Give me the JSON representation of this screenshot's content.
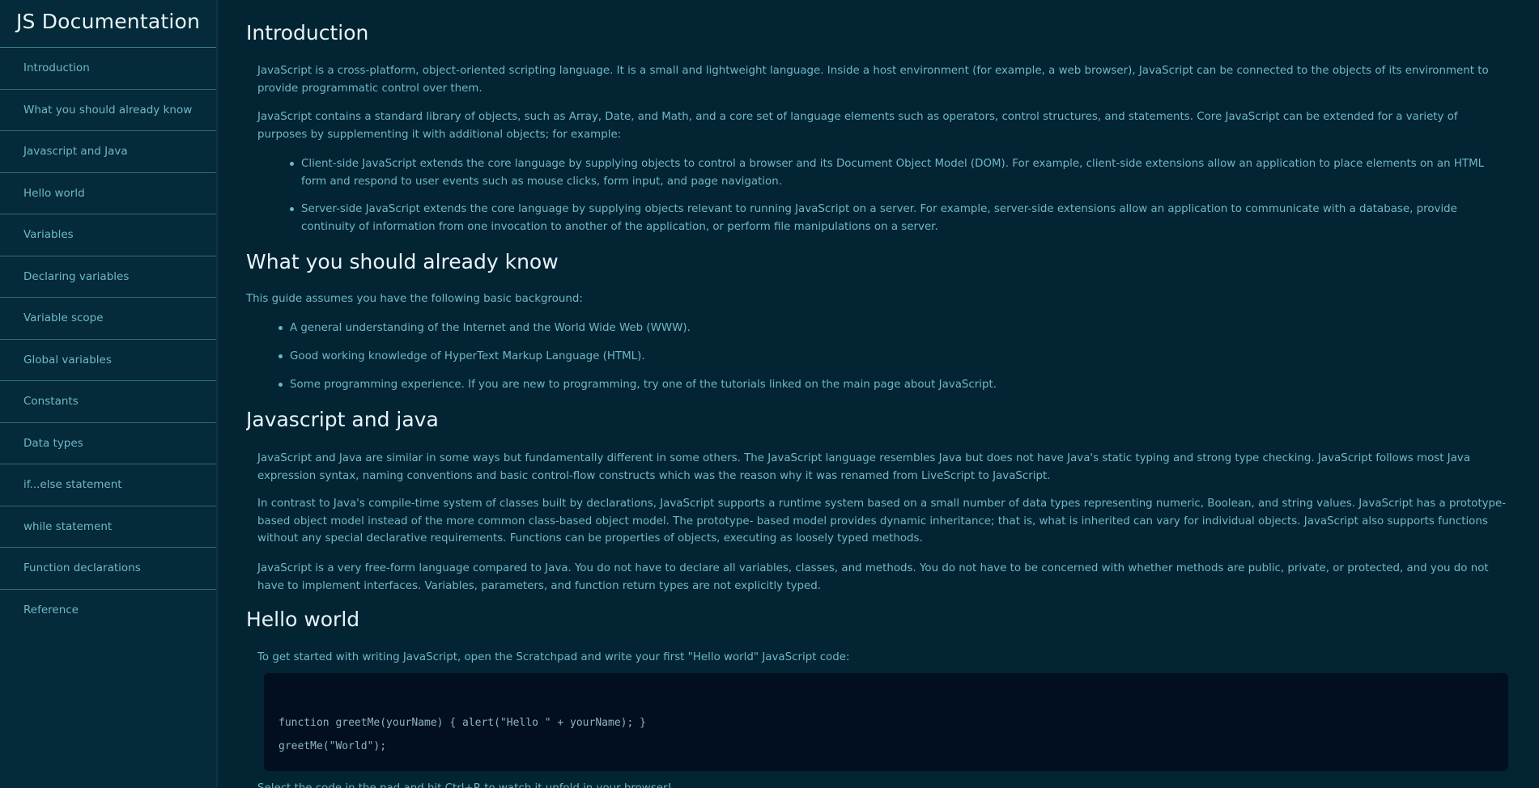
{
  "nav": {
    "header": "JS Documentation",
    "links": [
      "Introduction",
      "What you should already know",
      "Javascript and Java",
      "Hello world",
      "Variables",
      "Declaring variables",
      "Variable scope",
      "Global variables",
      "Constants",
      "Data types",
      "if...else statement",
      "while statement",
      "Function declarations",
      "Reference"
    ]
  },
  "sections": {
    "introduction": {
      "title": "Introduction",
      "p1": "JavaScript is a cross-platform, object-oriented scripting language. It is a small and lightweight language. Inside a host environment (for example, a web browser), JavaScript can be connected to the objects of its environment to provide programmatic control over them.",
      "p2": "JavaScript contains a standard library of objects, such as Array, Date, and Math, and a core set of language elements such as operators, control structures, and statements. Core JavaScript can be extended for a variety of purposes by supplementing it with additional objects; for example:",
      "items": [
        "Client-side JavaScript extends the core language by supplying objects to control a browser and its Document Object Model (DOM). For example, client-side extensions allow an application to place elements on an HTML form and respond to user events such as mouse clicks, form input, and page navigation.",
        "Server-side JavaScript extends the core language by supplying objects relevant to running JavaScript on a server. For example, server-side extensions allow an application to communicate with a database, provide continuity of information from one invocation to another of the application, or perform file manipulations on a server."
      ]
    },
    "already_know": {
      "title": "What you should already know",
      "p1": "This guide assumes you have the following basic background:",
      "items": [
        "A general understanding of the Internet and the World Wide Web (WWW).",
        "Good working knowledge of HyperText Markup Language (HTML).",
        "Some programming experience. If you are new to programming, try one of the tutorials linked on the main page about JavaScript."
      ]
    },
    "js_java": {
      "title": "Javascript and java",
      "p1": "JavaScript and Java are similar in some ways but fundamentally different in some others. The JavaScript language resembles Java but does not have Java's static typing and strong type checking. JavaScript follows most Java expression syntax, naming conventions and basic control-flow constructs which was the reason why it was renamed from LiveScript to JavaScript.",
      "p2": "In contrast to Java's compile-time system of classes built by declarations, JavaScript supports a runtime system based on a small number of data types representing numeric, Boolean, and string values. JavaScript has a prototype-based object model instead of the more common class-based object model. The prototype- based model provides dynamic inheritance; that is, what is inherited can vary for individual objects. JavaScript also supports functions without any special declarative requirements. Functions can be properties of objects, executing as loosely typed methods.",
      "p3": "JavaScript is a very free-form language compared to Java. You do not have to declare all variables, classes, and methods. You do not have to be concerned with whether methods are public, private, or protected, and you do not have to implement interfaces. Variables, parameters, and function return types are not explicitly typed."
    },
    "hello_world": {
      "title": "Hello world",
      "p1": "To get started with writing JavaScript, open the Scratchpad and write your first \"Hello world\" JavaScript code:",
      "code_line1": "function greetMe(yourName) { alert(\"Hello \" + yourName); }",
      "code_line2": "greetMe(\"World\");",
      "p2": "Select the code in the pad and hit Ctrl+R to watch it unfold in your browser!"
    }
  }
}
